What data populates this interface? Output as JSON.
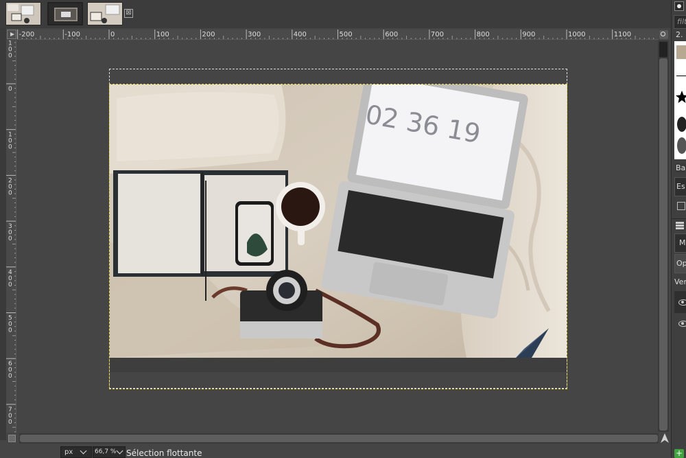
{
  "app": {
    "colors": {
      "canvas_bg": "#454545",
      "panel_bg": "#3c3c3c",
      "selection_marquee": "#e8d84a",
      "layer_boundary": "#dddddd",
      "dock_add_button": "#3fa33f"
    }
  },
  "image_tabs": [
    {
      "name": "tab-image-1",
      "active": false
    },
    {
      "name": "tab-image-2",
      "active": true
    },
    {
      "name": "tab-image-3",
      "active": false
    }
  ],
  "tab_close_symbol": "⊠",
  "ruler_h": {
    "labels": [
      "-200",
      "-100",
      "0",
      "100",
      "200",
      "300",
      "400",
      "500",
      "600",
      "700",
      "800",
      "900",
      "1000",
      "1100"
    ]
  },
  "ruler_v": {
    "labels": [
      "100",
      "0",
      "100",
      "200",
      "300",
      "400",
      "500",
      "600",
      "700"
    ]
  },
  "photo": {
    "clock_text": "02 36 19"
  },
  "statusbar": {
    "unit": "px",
    "zoom": "66,7 %",
    "message": "Sélection flottante"
  },
  "dock": {
    "filter_placeholder": "filt",
    "brush_list_label": "2. ",
    "tab_brushes": "Ba",
    "tab_spacing": "Es",
    "mode_label": "M",
    "opacity_label": "Op",
    "lock_label": "Ver"
  }
}
